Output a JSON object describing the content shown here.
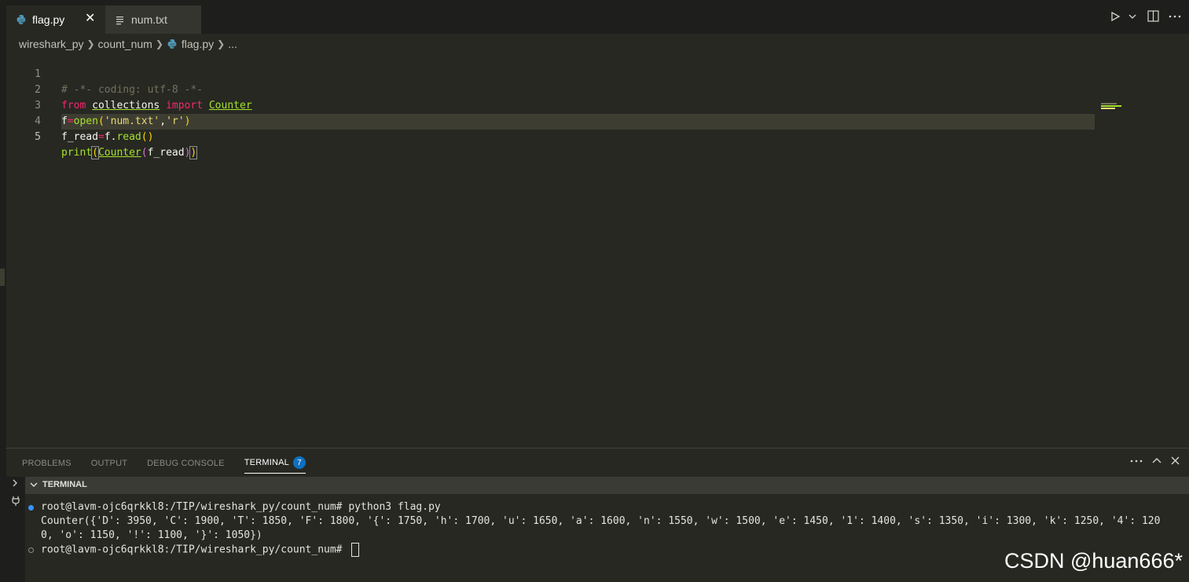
{
  "tabs": [
    {
      "label": "flag.py",
      "icon": "python-icon",
      "active": true
    },
    {
      "label": "num.txt",
      "icon": "text-file-icon",
      "active": false
    }
  ],
  "tab_close_glyph": "✕",
  "breadcrumb": [
    "wireshark_py",
    "count_num",
    "flag.py",
    "..."
  ],
  "editor": {
    "line_numbers": [
      "1",
      "2",
      "3",
      "4",
      "5"
    ],
    "current_line": 5
  },
  "code_tokens": {
    "l1": "# -*- coding: utf-8 -*-",
    "l2_from": "from",
    "l2_mod": "collections",
    "l2_import": "import",
    "l2_name": "Counter",
    "l3_var": "f",
    "l3_eq": "=",
    "l3_fn": "open",
    "l3_p1": "(",
    "l3_s1": "'num.txt'",
    "l3_comma": ",",
    "l3_s2": "'r'",
    "l3_p2": ")",
    "l4_var": "f_read",
    "l4_eq": "=",
    "l4_obj": "f.",
    "l4_fn": "read",
    "l4_paren": "()",
    "l5_fn": "print",
    "l5_p1": "(",
    "l5_cls": "Counter",
    "l5_p2": "(",
    "l5_arg": "f_read",
    "l5_p3": ")",
    "l5_p4": ")"
  },
  "panel": {
    "tabs": [
      "PROBLEMS",
      "OUTPUT",
      "DEBUG CONSOLE",
      "TERMINAL"
    ],
    "terminal_badge": "7",
    "terminal_title": "TERMINAL"
  },
  "terminal": {
    "line1": "root@lavm-ojc6qrkkl8:/TIP/wireshark_py/count_num# python3 flag.py",
    "line2": "Counter({'D': 3950, 'C': 1900, 'T': 1850, 'F': 1800, '{': 1750, 'h': 1700, 'u': 1650, 'a': 1600, 'n': 1550, 'w': 1500, 'e': 1450, '1': 1400, 's': 1350, 'i': 1300, 'k': 1250, '4': 120",
    "line3": "0, 'o': 1150, '!': 1100, '}': 1050})",
    "line4": "root@lavm-ojc6qrkkl8:/TIP/wireshark_py/count_num# "
  },
  "watermark": "CSDN @huan666*",
  "colors": {
    "background": "#272822",
    "keyword": "#f92672",
    "function": "#a6e22e",
    "string": "#e6db74",
    "comment": "#75715e",
    "badge": "#0e70c0"
  }
}
